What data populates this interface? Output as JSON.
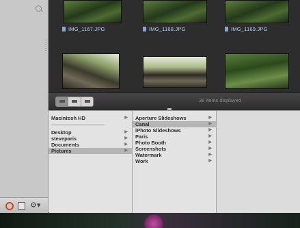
{
  "browser": {
    "thumbnails": [
      {
        "filename": "IMG_1167.JPG"
      },
      {
        "filename": "IMG_1168.JPG"
      },
      {
        "filename": "IMG_1169.JPG"
      }
    ],
    "status": "38 items displayed"
  },
  "columns": {
    "col1": [
      "Macintosh HD",
      "Desktop",
      "steveparis",
      "Documents",
      "Pictures"
    ],
    "col1_selected": "Pictures",
    "col2": [
      "Aperture Slideshows",
      "Canal",
      "iPhoto Slideshows",
      "Paris",
      "Photo Booth",
      "Screenshots",
      "Watermark",
      "Work"
    ],
    "col2_selected": "Canal"
  },
  "sidebar_toolbar": {
    "action_label": "⚙▾"
  },
  "icons": {
    "search": "search-icon",
    "add": "add-folder-icon",
    "save": "save-icon",
    "action": "gear-icon",
    "file": "file-icon"
  },
  "colors": {
    "selection": "#b5b5b5",
    "caption": "#c7d6f2",
    "accent_add": "#d0461f"
  }
}
